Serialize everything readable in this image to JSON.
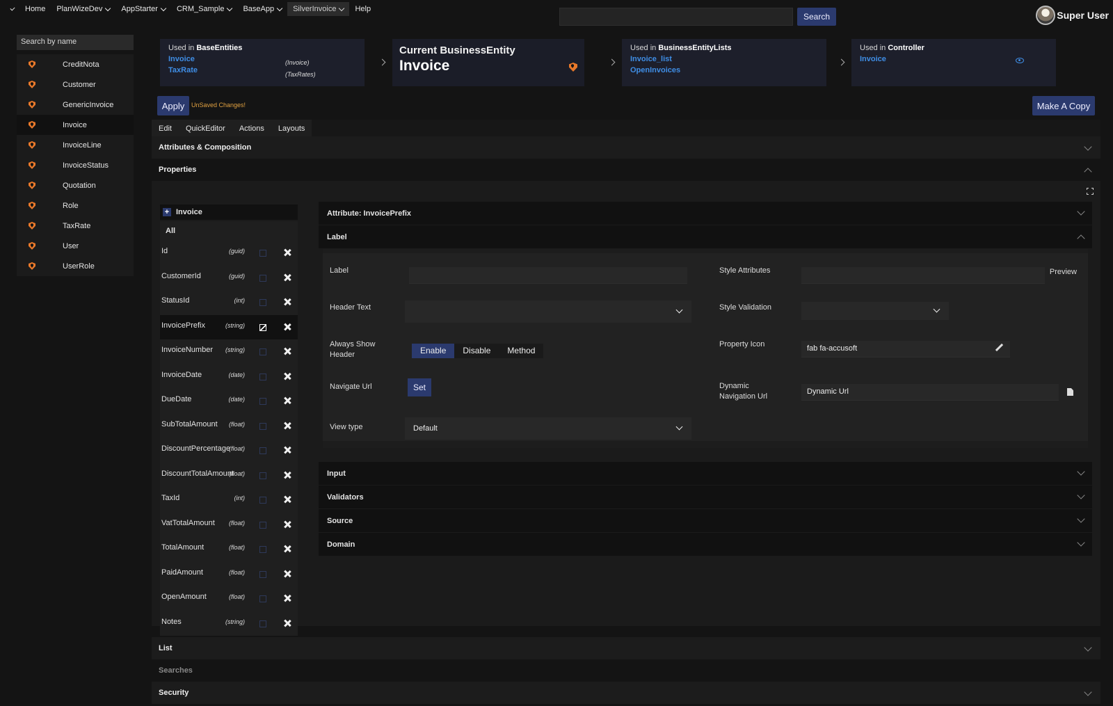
{
  "nav": {
    "items": [
      {
        "label": "Home",
        "dropdown": false,
        "active": false
      },
      {
        "label": "PlanWizeDev",
        "dropdown": true,
        "active": false
      },
      {
        "label": "AppStarter",
        "dropdown": true,
        "active": false
      },
      {
        "label": "CRM_Sample",
        "dropdown": true,
        "active": false
      },
      {
        "label": "BaseApp",
        "dropdown": true,
        "active": false
      },
      {
        "label": "SilverInvoice",
        "dropdown": true,
        "active": true
      },
      {
        "label": "Help",
        "dropdown": false,
        "active": false
      }
    ],
    "search_value": "",
    "search_button": "Search",
    "user_name": "Super User"
  },
  "sidebar": {
    "search_placeholder": "Search by name",
    "items": [
      "CreditNota",
      "Customer",
      "GenericInvoice",
      "Invoice",
      "InvoiceLine",
      "InvoiceStatus",
      "Quotation",
      "Role",
      "TaxRate",
      "User",
      "UserRole"
    ],
    "selected": "Invoice"
  },
  "refs": {
    "base_entities": {
      "prefix": "Used in",
      "title": "BaseEntities",
      "links": [
        {
          "name": "Invoice",
          "type": "(Invoice)"
        },
        {
          "name": "TaxRate",
          "type": "(TaxRates)"
        }
      ]
    },
    "current": {
      "title": "Current BusinessEntity",
      "name": "Invoice"
    },
    "lists": {
      "prefix": "Used in",
      "title": "BusinessEntityLists",
      "links": [
        {
          "name": "Invoice_list"
        },
        {
          "name": "OpenInvoices"
        }
      ]
    },
    "controller": {
      "prefix": "Used in",
      "title": "Controller",
      "links": [
        {
          "name": "Invoice"
        }
      ]
    }
  },
  "toolbar": {
    "apply": "Apply",
    "unsaved": "UnSaved Changes!",
    "copy": "Make A Copy"
  },
  "tabs": [
    "Edit",
    "QuickEditor",
    "Actions",
    "Layouts"
  ],
  "sections": {
    "attributes": "Attributes & Composition",
    "properties": "Properties",
    "list": "List",
    "searches": "Searches",
    "security": "Security"
  },
  "attributes": {
    "root": "Invoice",
    "all": "All",
    "selected": "InvoicePrefix",
    "items": [
      {
        "name": "Id",
        "type": "(guid)"
      },
      {
        "name": "CustomerId",
        "type": "(guid)"
      },
      {
        "name": "StatusId",
        "type": "(int)"
      },
      {
        "name": "InvoicePrefix",
        "type": "(string)"
      },
      {
        "name": "InvoiceNumber",
        "type": "(string)"
      },
      {
        "name": "InvoiceDate",
        "type": "(date)"
      },
      {
        "name": "DueDate",
        "type": "(date)"
      },
      {
        "name": "SubTotalAmount",
        "type": "(float)"
      },
      {
        "name": "DiscountPercentage",
        "type": "(float)"
      },
      {
        "name": "DiscountTotalAmount",
        "type": "(float)"
      },
      {
        "name": "TaxId",
        "type": "(int)"
      },
      {
        "name": "VatTotalAmount",
        "type": "(float)"
      },
      {
        "name": "TotalAmount",
        "type": "(float)"
      },
      {
        "name": "PaidAmount",
        "type": "(float)"
      },
      {
        "name": "OpenAmount",
        "type": "(float)"
      },
      {
        "name": "Notes",
        "type": "(string)"
      }
    ]
  },
  "detail": {
    "title": "Attribute: InvoicePrefix",
    "label_section": "Label",
    "fields": {
      "label": {
        "label": "Label",
        "value": ""
      },
      "header_text": {
        "label": "Header Text",
        "value": ""
      },
      "always_show_header": {
        "label": "Always Show Header",
        "options": [
          "Enable",
          "Disable",
          "Method"
        ],
        "selected": "Enable"
      },
      "navigate_url": {
        "label": "Navigate Url",
        "button": "Set"
      },
      "view_type": {
        "label": "View type",
        "value": "Default"
      },
      "style_attributes": {
        "label": "Style Attributes",
        "value": "",
        "preview": "Preview"
      },
      "style_validation": {
        "label": "Style Validation",
        "value": ""
      },
      "property_icon": {
        "label": "Property Icon",
        "value": "fab fa-accusoft"
      },
      "dynamic_nav": {
        "label": "Dynamic Navigation Url",
        "value": "Dynamic Url"
      }
    },
    "collapsed": [
      "Input",
      "Validators",
      "Source",
      "Domain"
    ]
  },
  "colors": {
    "accent": "#2b3a6e",
    "link": "#3f8ee6",
    "shield": "#e8782a",
    "warning": "#e0a040"
  }
}
